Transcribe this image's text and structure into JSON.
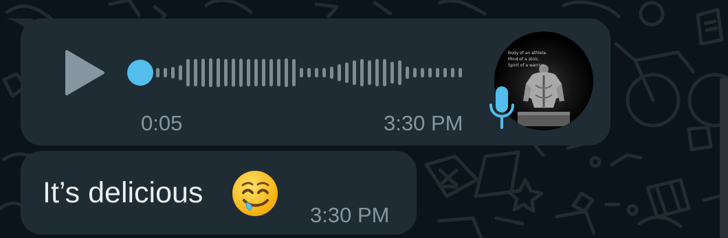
{
  "voice_message": {
    "duration": "0:05",
    "time": "3:30 PM",
    "progress": 0,
    "avatar_caption": [
      "Body of an athlete.",
      "Mind of a stoic.",
      "Spirit of a warrior."
    ],
    "icons": {
      "play": "play-icon",
      "mic": "microphone-icon",
      "avatar": "contact-avatar"
    },
    "colors": {
      "accent": "#53bdeb",
      "wave": "#7f8b93",
      "play": "#8696a0"
    }
  },
  "text_message": {
    "text": "It’s delicious",
    "emoji": "drooling-face",
    "time": "3:30 PM"
  },
  "theme": {
    "background": "#0b141a",
    "bubble": "#1f2c34",
    "text": "#e9edef",
    "meta": "#8696a0"
  }
}
